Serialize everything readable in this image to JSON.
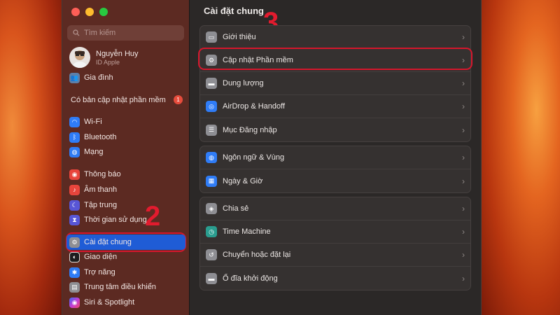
{
  "sidebar": {
    "search_placeholder": "Tìm kiếm",
    "profile": {
      "name": "Nguyễn Huy",
      "subtitle": "ID Apple"
    },
    "family": "Gia đình",
    "update_notice": {
      "label": "Có bản cập nhật phần mềm",
      "count": "1"
    },
    "items": [
      {
        "label": "Wi-Fi",
        "icon": "wifi-icon",
        "color": "#2f7cf6"
      },
      {
        "label": "Bluetooth",
        "icon": "bluetooth-icon",
        "color": "#2f7cf6"
      },
      {
        "label": "Mạng",
        "icon": "globe-icon",
        "color": "#2f7cf6"
      },
      {
        "label": "Thông báo",
        "icon": "bell-icon",
        "color": "#e8453c"
      },
      {
        "label": "Âm thanh",
        "icon": "speaker-icon",
        "color": "#e8453c"
      },
      {
        "label": "Tập trung",
        "icon": "moon-icon",
        "color": "#5856d6"
      },
      {
        "label": "Thời gian sử dụng",
        "icon": "hourglass-icon",
        "color": "#5856d6"
      },
      {
        "label": "Cài đặt chung",
        "icon": "gear-icon",
        "color": "#8e8e93"
      },
      {
        "label": "Giao diện",
        "icon": "appearance-icon",
        "color": "#1c1c1e"
      },
      {
        "label": "Trợ năng",
        "icon": "accessibility-icon",
        "color": "#2f7cf6"
      },
      {
        "label": "Trung tâm điều khiển",
        "icon": "control-center-icon",
        "color": "#8e8e93"
      },
      {
        "label": "Siri & Spotlight",
        "icon": "siri-icon",
        "color": "#c33cd9"
      }
    ]
  },
  "annotations": {
    "step2": "2",
    "step3": "3"
  },
  "main": {
    "title": "Cài đặt chung",
    "groups": [
      [
        {
          "label": "Giới thiệu",
          "icon": "laptop-icon",
          "color": "#8e8e93"
        },
        {
          "label": "Cập nhật Phần mềm",
          "icon": "gear-badge-icon",
          "color": "#8e8e93"
        },
        {
          "label": "Dung lượng",
          "icon": "disk-icon",
          "color": "#8e8e93"
        },
        {
          "label": "AirDrop & Handoff",
          "icon": "airdrop-icon",
          "color": "#2f7cf6"
        },
        {
          "label": "Mục Đăng nhập",
          "icon": "list-icon",
          "color": "#8e8e93"
        }
      ],
      [
        {
          "label": "Ngôn ngữ & Vùng",
          "icon": "globe-icon",
          "color": "#2f7cf6"
        },
        {
          "label": "Ngày & Giờ",
          "icon": "calendar-clock-icon",
          "color": "#2f7cf6"
        }
      ],
      [
        {
          "label": "Chia sẻ",
          "icon": "share-icon",
          "color": "#8e8e93"
        },
        {
          "label": "Time Machine",
          "icon": "time-machine-icon",
          "color": "#2a9d8f"
        },
        {
          "label": "Chuyển hoặc đặt lại",
          "icon": "reset-icon",
          "color": "#8e8e93"
        },
        {
          "label": "Ổ đĩa khởi động",
          "icon": "startup-disk-icon",
          "color": "#8e8e93"
        }
      ]
    ]
  }
}
